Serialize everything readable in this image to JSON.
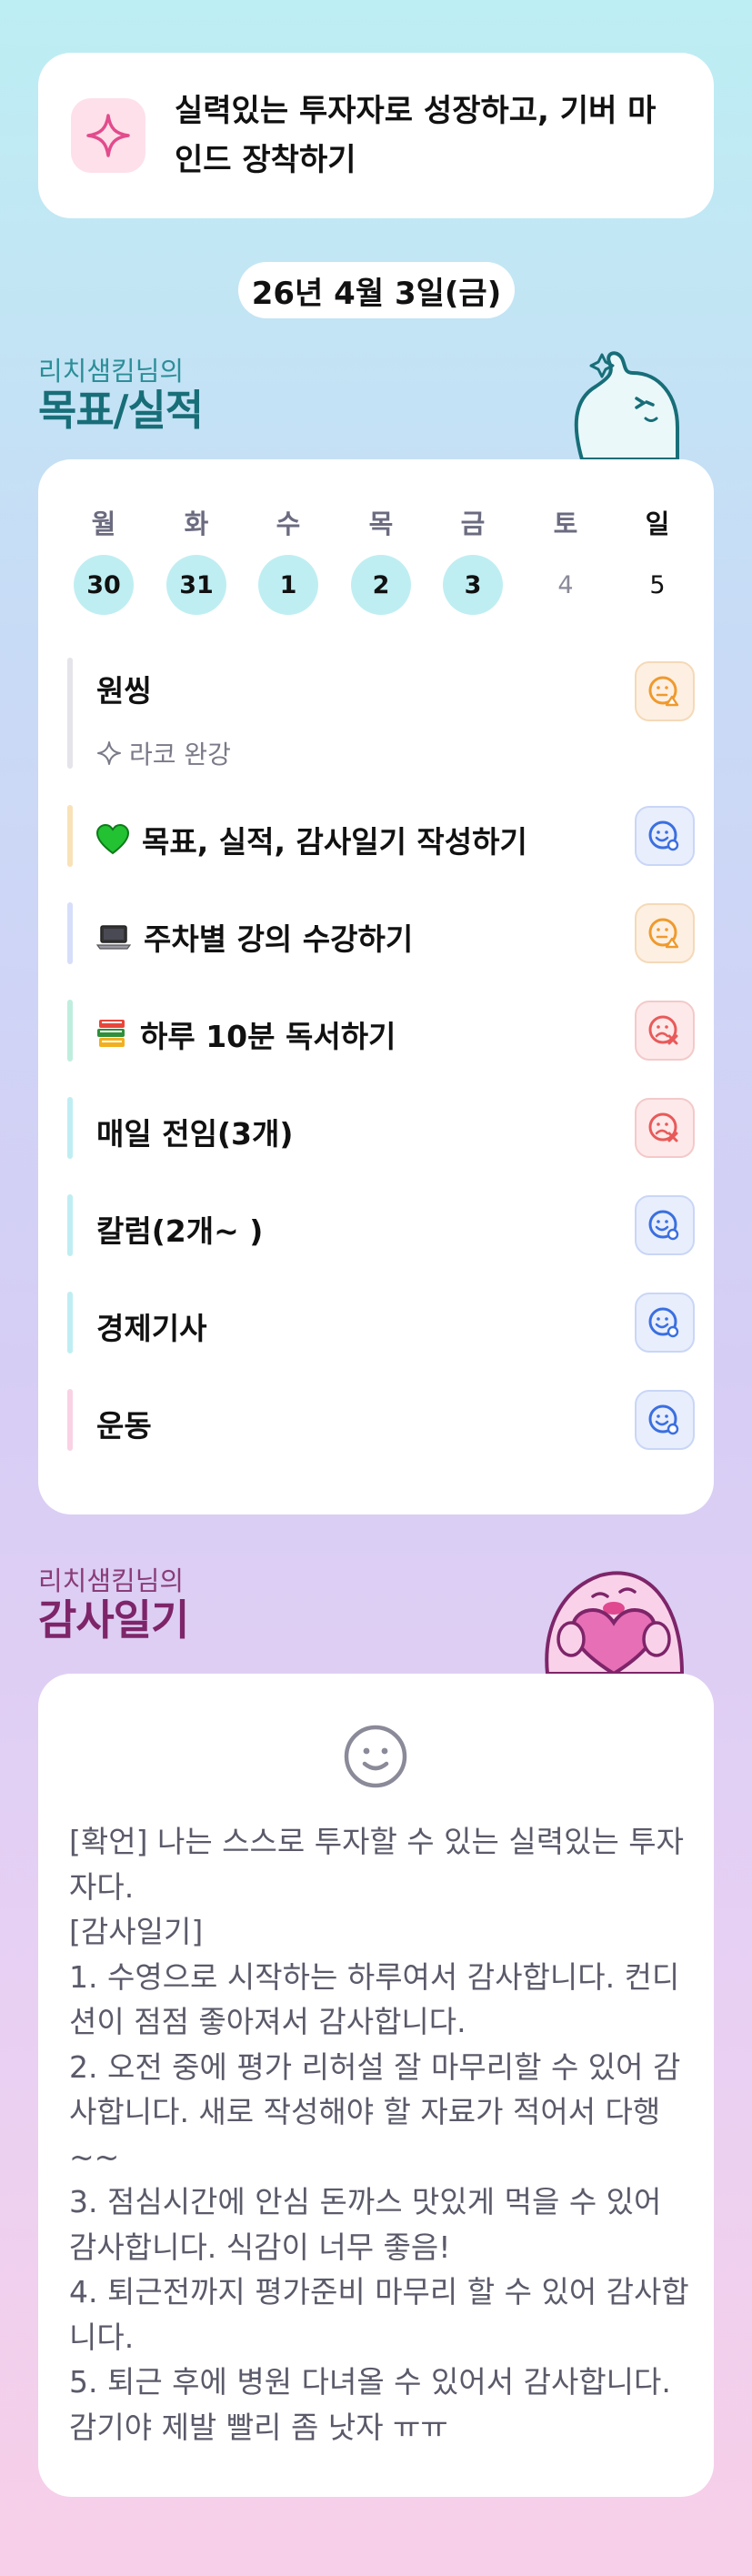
{
  "goal": {
    "icon": "sparkle-icon",
    "text": "실력있는 투자자로 성장하고, 기버 마인드 장착하기"
  },
  "date_label": "26년 4월 3일(금)",
  "goals_section": {
    "subtitle": "리치샘킴님의",
    "title": "목표/실적"
  },
  "week": {
    "days": [
      "월",
      "화",
      "수",
      "목",
      "금",
      "토",
      "일"
    ],
    "dates": [
      "30",
      "31",
      "1",
      "2",
      "3",
      "4",
      "5"
    ]
  },
  "tasks": [
    {
      "label": "원씽",
      "emoji": "",
      "status": "partial",
      "bar_color": "#e4e4ea"
    },
    {
      "label": "목표, 실적, 감사일기 작성하기",
      "emoji": "green-heart-icon",
      "status": "done",
      "bar_color": "#f9e2b8"
    },
    {
      "label": "주차별 강의 수강하기",
      "emoji": "laptop-icon",
      "status": "partial",
      "bar_color": "#d6defa"
    },
    {
      "label": "하루 10분 독서하기",
      "emoji": "books-icon",
      "status": "failed",
      "bar_color": "#bfeedd"
    },
    {
      "label": "매일 전임(3개)",
      "emoji": "",
      "status": "failed",
      "bar_color": "#bfeef2"
    },
    {
      "label": "칼럼(2개~ )",
      "emoji": "",
      "status": "done",
      "bar_color": "#bfeef2"
    },
    {
      "label": "경제기사",
      "emoji": "",
      "status": "done",
      "bar_color": "#bfeef2"
    },
    {
      "label": "운동",
      "emoji": "",
      "status": "done",
      "bar_color": "#f9d2e4"
    }
  ],
  "subtask": {
    "icon": "sparkle-outline-icon",
    "label": "라코 완강"
  },
  "gratitude_section": {
    "subtitle": "리치샘킴님의",
    "title": "감사일기"
  },
  "diary": {
    "mood_icon": "smiley-icon",
    "text": "[확언] 나는 스스로 투자할 수 있는 실력있는 투자자다.\n[감사일기]\n1. 수영으로 시작하는 하루여서 감사합니다. 컨디션이 점점 좋아져서 감사합니다.\n2. 오전 중에 평가 리허설 잘 마무리할 수 있어 감사합니다. 새로 작성해야 할 자료가 적어서 다행~~\n3. 점심시간에 안심 돈까스 맛있게 먹을 수 있어 감사합니다. 식감이 너무 좋음!\n4. 퇴근전까지 평가준비 마무리 할 수 있어 감사합니다.\n5. 퇴근 후에 병원 다녀올 수 있어서 감사합니다. 감기야 제발 빨리 좀 낫자 ㅠㅠ"
  },
  "colors": {
    "accent_teal": "#176e78",
    "accent_plum": "#7e2569",
    "status_done": "#3b6fe0",
    "status_partial": "#ef9a2e",
    "status_failed": "#e85a5a"
  }
}
